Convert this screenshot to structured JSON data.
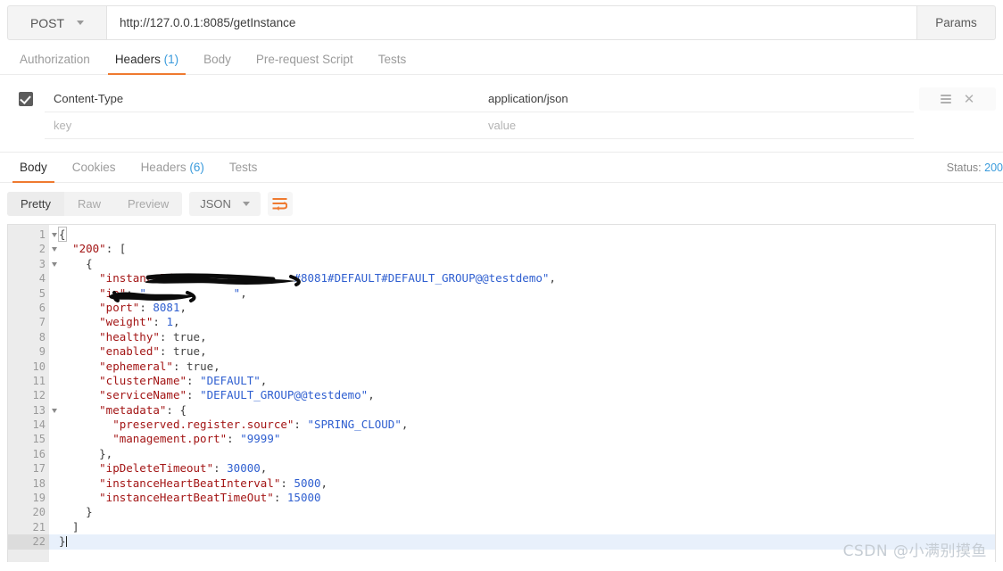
{
  "request": {
    "method": "POST",
    "url": "http://127.0.0.1:8085/getInstance",
    "params_label": "Params",
    "tabs": [
      {
        "label": "Authorization",
        "count": "",
        "active": false
      },
      {
        "label": "Headers",
        "count": "(1)",
        "active": true
      },
      {
        "label": "Body",
        "count": "",
        "active": false
      },
      {
        "label": "Pre-request Script",
        "count": "",
        "active": false
      },
      {
        "label": "Tests",
        "count": "",
        "active": false
      }
    ],
    "headers": [
      {
        "checked": true,
        "key": "Content-Type",
        "value": "application/json",
        "has_actions": true
      },
      {
        "checked": false,
        "key": "",
        "value": "",
        "key_placeholder": "key",
        "value_placeholder": "value",
        "has_actions": false
      }
    ]
  },
  "response": {
    "tabs": [
      {
        "label": "Body",
        "count": "",
        "active": true
      },
      {
        "label": "Cookies",
        "count": "",
        "active": false
      },
      {
        "label": "Headers",
        "count": "(6)",
        "active": false
      },
      {
        "label": "Tests",
        "count": "",
        "active": false
      }
    ],
    "status_label": "Status:",
    "status_code": "200",
    "view_modes": [
      {
        "label": "Pretty",
        "active": true
      },
      {
        "label": "Raw",
        "active": false
      },
      {
        "label": "Preview",
        "active": false
      }
    ],
    "format": "JSON",
    "wrap_icon": "word-wrap-icon"
  },
  "body_lines": [
    {
      "num": "1",
      "fold": true,
      "current": false,
      "tokens": [
        {
          "t": "{",
          "c": "p",
          "hl": true
        }
      ]
    },
    {
      "num": "2",
      "fold": true,
      "current": false,
      "tokens": [
        {
          "t": "  ",
          "c": "p"
        },
        {
          "t": "\"200\"",
          "c": "k"
        },
        {
          "t": ": [",
          "c": "p"
        }
      ]
    },
    {
      "num": "3",
      "fold": true,
      "current": false,
      "tokens": [
        {
          "t": "    {",
          "c": "p"
        }
      ]
    },
    {
      "num": "4",
      "fold": false,
      "current": false,
      "tokens": [
        {
          "t": "      ",
          "c": "p"
        },
        {
          "t": "\"instanceId\"",
          "c": "k"
        },
        {
          "t": ": ",
          "c": "p"
        },
        {
          "t": "\"              #8081#DEFAULT#DEFAULT_GROUP@@testdemo\"",
          "c": "s"
        },
        {
          "t": ",",
          "c": "p"
        }
      ]
    },
    {
      "num": "5",
      "fold": false,
      "current": false,
      "tokens": [
        {
          "t": "      ",
          "c": "p"
        },
        {
          "t": "\"ip\"",
          "c": "k"
        },
        {
          "t": ": ",
          "c": "p"
        },
        {
          "t": "\"             \"",
          "c": "s"
        },
        {
          "t": ",",
          "c": "p"
        }
      ]
    },
    {
      "num": "6",
      "fold": false,
      "current": false,
      "tokens": [
        {
          "t": "      ",
          "c": "p"
        },
        {
          "t": "\"port\"",
          "c": "k"
        },
        {
          "t": ": ",
          "c": "p"
        },
        {
          "t": "8081",
          "c": "n"
        },
        {
          "t": ",",
          "c": "p"
        }
      ]
    },
    {
      "num": "7",
      "fold": false,
      "current": false,
      "tokens": [
        {
          "t": "      ",
          "c": "p"
        },
        {
          "t": "\"weight\"",
          "c": "k"
        },
        {
          "t": ": ",
          "c": "p"
        },
        {
          "t": "1",
          "c": "n"
        },
        {
          "t": ",",
          "c": "p"
        }
      ]
    },
    {
      "num": "8",
      "fold": false,
      "current": false,
      "tokens": [
        {
          "t": "      ",
          "c": "p"
        },
        {
          "t": "\"healthy\"",
          "c": "k"
        },
        {
          "t": ": ",
          "c": "p"
        },
        {
          "t": "true",
          "c": "b"
        },
        {
          "t": ",",
          "c": "p"
        }
      ]
    },
    {
      "num": "9",
      "fold": false,
      "current": false,
      "tokens": [
        {
          "t": "      ",
          "c": "p"
        },
        {
          "t": "\"enabled\"",
          "c": "k"
        },
        {
          "t": ": ",
          "c": "p"
        },
        {
          "t": "true",
          "c": "b"
        },
        {
          "t": ",",
          "c": "p"
        }
      ]
    },
    {
      "num": "10",
      "fold": false,
      "current": false,
      "tokens": [
        {
          "t": "      ",
          "c": "p"
        },
        {
          "t": "\"ephemeral\"",
          "c": "k"
        },
        {
          "t": ": ",
          "c": "p"
        },
        {
          "t": "true",
          "c": "b"
        },
        {
          "t": ",",
          "c": "p"
        }
      ]
    },
    {
      "num": "11",
      "fold": false,
      "current": false,
      "tokens": [
        {
          "t": "      ",
          "c": "p"
        },
        {
          "t": "\"clusterName\"",
          "c": "k"
        },
        {
          "t": ": ",
          "c": "p"
        },
        {
          "t": "\"DEFAULT\"",
          "c": "s"
        },
        {
          "t": ",",
          "c": "p"
        }
      ]
    },
    {
      "num": "12",
      "fold": false,
      "current": false,
      "tokens": [
        {
          "t": "      ",
          "c": "p"
        },
        {
          "t": "\"serviceName\"",
          "c": "k"
        },
        {
          "t": ": ",
          "c": "p"
        },
        {
          "t": "\"DEFAULT_GROUP@@testdemo\"",
          "c": "s"
        },
        {
          "t": ",",
          "c": "p"
        }
      ]
    },
    {
      "num": "13",
      "fold": true,
      "current": false,
      "tokens": [
        {
          "t": "      ",
          "c": "p"
        },
        {
          "t": "\"metadata\"",
          "c": "k"
        },
        {
          "t": ": {",
          "c": "p"
        }
      ]
    },
    {
      "num": "14",
      "fold": false,
      "current": false,
      "tokens": [
        {
          "t": "        ",
          "c": "p"
        },
        {
          "t": "\"preserved.register.source\"",
          "c": "k"
        },
        {
          "t": ": ",
          "c": "p"
        },
        {
          "t": "\"SPRING_CLOUD\"",
          "c": "s"
        },
        {
          "t": ",",
          "c": "p"
        }
      ]
    },
    {
      "num": "15",
      "fold": false,
      "current": false,
      "tokens": [
        {
          "t": "        ",
          "c": "p"
        },
        {
          "t": "\"management.port\"",
          "c": "k"
        },
        {
          "t": ": ",
          "c": "p"
        },
        {
          "t": "\"9999\"",
          "c": "s"
        }
      ]
    },
    {
      "num": "16",
      "fold": false,
      "current": false,
      "tokens": [
        {
          "t": "      },",
          "c": "p"
        }
      ]
    },
    {
      "num": "17",
      "fold": false,
      "current": false,
      "tokens": [
        {
          "t": "      ",
          "c": "p"
        },
        {
          "t": "\"ipDeleteTimeout\"",
          "c": "k"
        },
        {
          "t": ": ",
          "c": "p"
        },
        {
          "t": "30000",
          "c": "n"
        },
        {
          "t": ",",
          "c": "p"
        }
      ]
    },
    {
      "num": "18",
      "fold": false,
      "current": false,
      "tokens": [
        {
          "t": "      ",
          "c": "p"
        },
        {
          "t": "\"instanceHeartBeatInterval\"",
          "c": "k"
        },
        {
          "t": ": ",
          "c": "p"
        },
        {
          "t": "5000",
          "c": "n"
        },
        {
          "t": ",",
          "c": "p"
        }
      ]
    },
    {
      "num": "19",
      "fold": false,
      "current": false,
      "tokens": [
        {
          "t": "      ",
          "c": "p"
        },
        {
          "t": "\"instanceHeartBeatTimeOut\"",
          "c": "k"
        },
        {
          "t": ": ",
          "c": "p"
        },
        {
          "t": "15000",
          "c": "n"
        }
      ]
    },
    {
      "num": "20",
      "fold": false,
      "current": false,
      "tokens": [
        {
          "t": "    }",
          "c": "p"
        }
      ]
    },
    {
      "num": "21",
      "fold": false,
      "current": false,
      "tokens": [
        {
          "t": "  ]",
          "c": "p"
        }
      ]
    },
    {
      "num": "22",
      "fold": false,
      "current": true,
      "tokens": [
        {
          "t": "}",
          "c": "p"
        },
        {
          "t": "CARET",
          "c": "caret"
        }
      ]
    }
  ],
  "watermark": "CSDN @小满别摸鱼",
  "colors": {
    "accent": "#ef7a30",
    "link": "#3a9bdc",
    "json_key": "#a31515",
    "json_string": "#2f5fd0",
    "json_number": "#2f5fd0",
    "current_line": "#e8f0fb"
  }
}
